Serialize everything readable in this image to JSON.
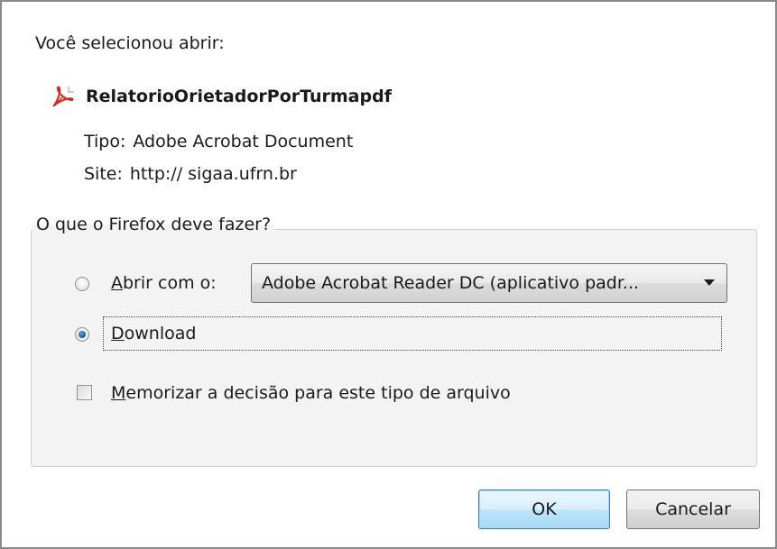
{
  "dialog": {
    "intro": "Você selecionou abrir:",
    "file": {
      "name": "RelatorioOrietadorPorTurmapdf",
      "icon": "pdf-file-icon",
      "type_label": "Tipo:",
      "type_value": "Adobe Acrobat Document",
      "site_label": "Site:",
      "site_value": "http:// sigaa.ufrn.br"
    },
    "options": {
      "legend": "O que o Firefox deve fazer?",
      "open_with_accesskey": "A",
      "open_with_rest": "brir com o:",
      "open_with_checked": false,
      "app_select_value": "Adobe Acrobat Reader DC  (aplicativo padr...",
      "download_accesskey": "D",
      "download_rest": "ownload",
      "download_checked": true,
      "remember_accesskey": "M",
      "remember_rest": "emorizar a decisão para este tipo de arquivo",
      "remember_checked": false
    },
    "buttons": {
      "ok": "OK",
      "cancel": "Cancelar"
    },
    "colors": {
      "pdf_red": "#d9261c",
      "ok_border": "#3c7fb1",
      "radio_selected": "#1f5ba8"
    }
  }
}
